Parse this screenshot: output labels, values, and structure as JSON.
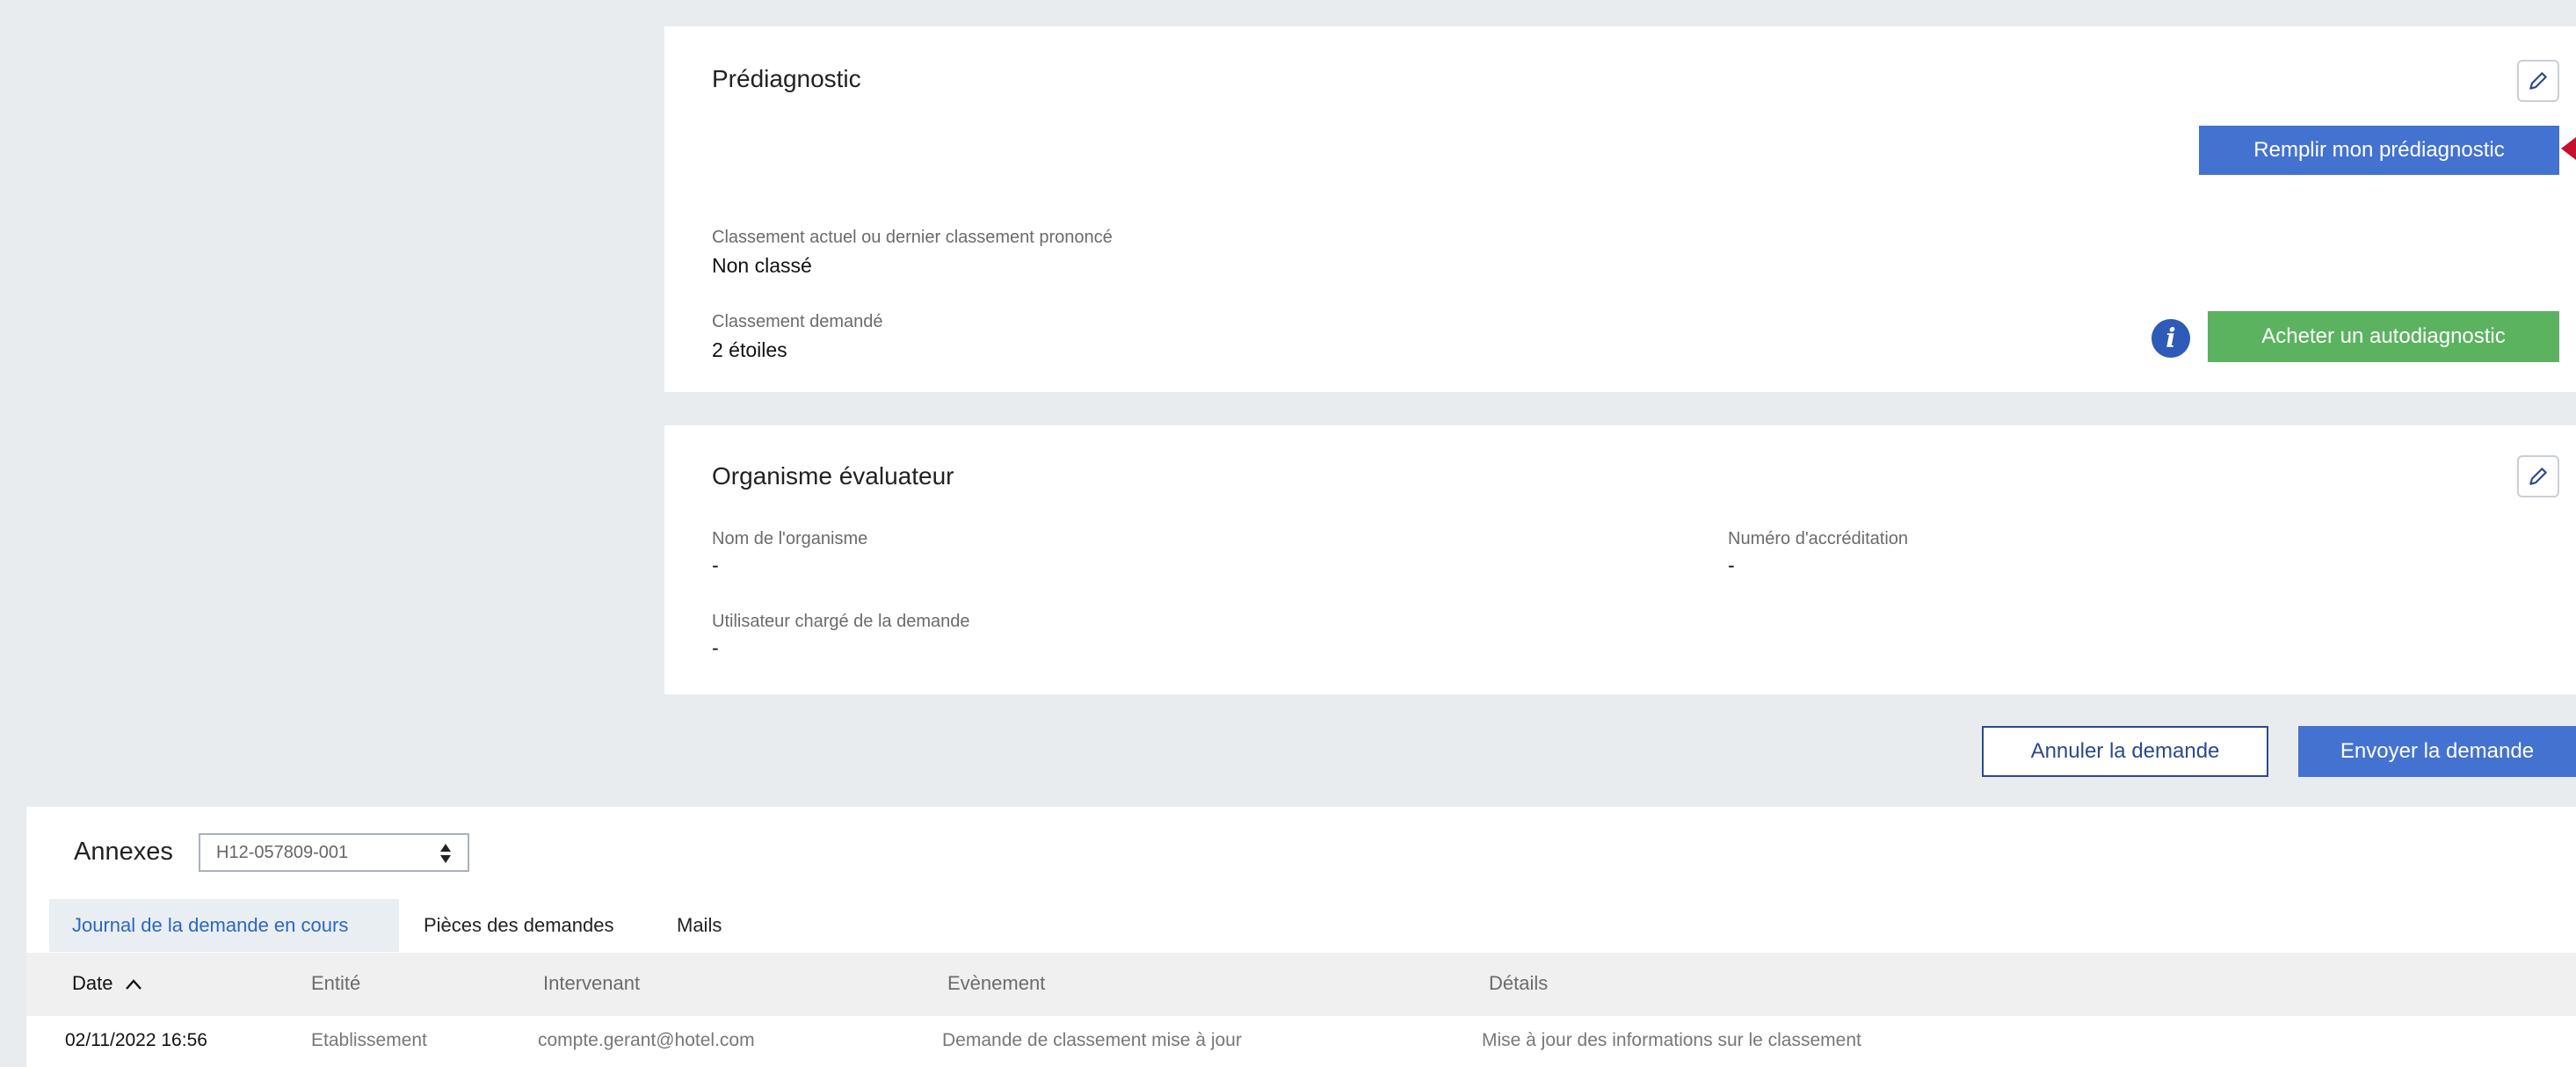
{
  "prediagnostic": {
    "title": "Prédiagnostic",
    "fill_button": "Remplir mon prédiagnostic",
    "current_label": "Classement actuel ou dernier classement prononcé",
    "current_value": "Non classé",
    "requested_label": "Classement demandé",
    "requested_value": "2 étoiles",
    "buy_button": "Acheter un autodiagnostic"
  },
  "evaluator": {
    "title": "Organisme évaluateur",
    "org_name_label": "Nom de l'organisme",
    "org_name_value": "-",
    "accreditation_label": "Numéro d'accréditation",
    "accreditation_value": "-",
    "user_label": "Utilisateur chargé de la demande",
    "user_value": "-"
  },
  "actions": {
    "cancel": "Annuler la demande",
    "send": "Envoyer la demande"
  },
  "annexes": {
    "label": "Annexes",
    "selected": "H12-057809-001"
  },
  "tabs": [
    {
      "label": "Journal de la demande en cours",
      "active": true
    },
    {
      "label": "Pièces des demandes",
      "active": false
    },
    {
      "label": "Mails",
      "active": false
    }
  ],
  "table": {
    "headers": [
      "Date",
      "Entité",
      "Intervenant",
      "Evènement",
      "Détails"
    ],
    "sort_indicator": "ascending",
    "rows": [
      [
        "02/11/2022 16:56",
        "Etablissement",
        "compte.gerant@hotel.com",
        "Demande de classement mise à jour",
        "Mise à jour des informations sur le classement"
      ]
    ]
  },
  "colors": {
    "primary": "#4472d1",
    "success": "#5bb360",
    "outline": "#2b4a8a",
    "active_tab_text": "#2d66c3",
    "page_background": "#e9ecef"
  },
  "icons": [
    "pencil-icon",
    "info-icon",
    "sort-up-icon",
    "select-arrows-icon",
    "pointer-arrow-icon"
  ]
}
